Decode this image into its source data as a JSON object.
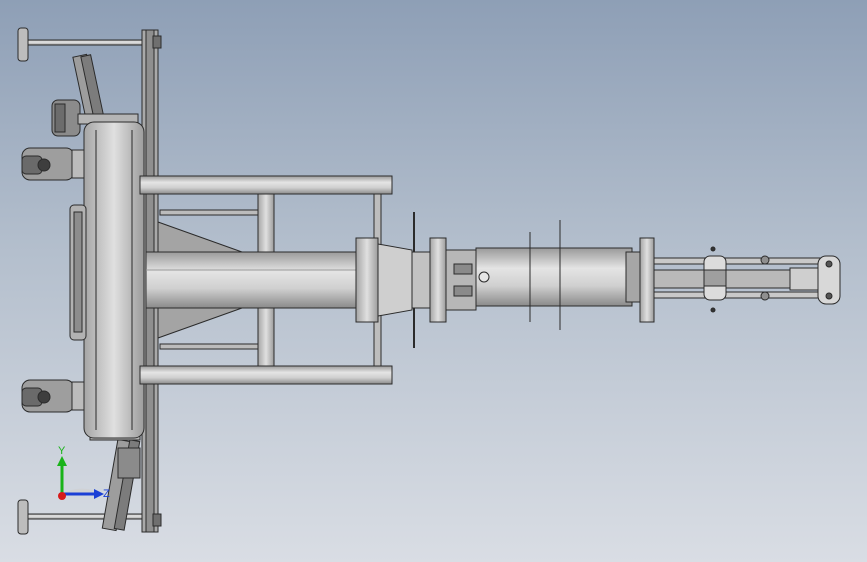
{
  "viewport": {
    "background_top": "#8e9fb6",
    "background_bottom": "#d9dde4"
  },
  "model": {
    "line_color": "#2b2b2b",
    "metal_light": "#d6d6d6",
    "metal_mid": "#b9b9b9",
    "metal_dark": "#8f8f8f"
  },
  "triad": {
    "y_label": "Y",
    "z_label": "Z",
    "y_color": "#19b319",
    "z_color": "#1a3fd6",
    "x_color": "#d61a1a"
  }
}
